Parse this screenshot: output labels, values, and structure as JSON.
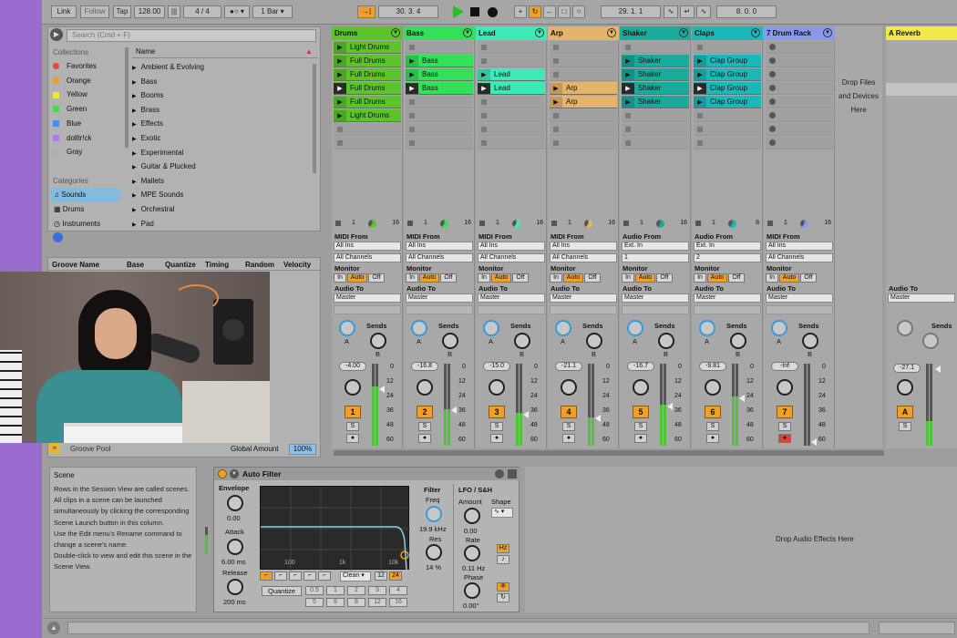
{
  "transport": {
    "link": "Link",
    "follow": "Follow",
    "tap": "Tap",
    "tempo": "128.00",
    "signature": "4 / 4",
    "metro": "1 Bar",
    "position": "30.   3.   4",
    "loop_start": "29.   1.   1",
    "loop_len": "8.   0.   0"
  },
  "browser": {
    "search_placeholder": "Search (Cmd + F)",
    "name_header": "Name",
    "collections_header": "Collections",
    "collections": [
      {
        "label": "Favorites",
        "color": "#e8463e"
      },
      {
        "label": "Orange",
        "color": "#f39a2a"
      },
      {
        "label": "Yellow",
        "color": "#f2e63c"
      },
      {
        "label": "Green",
        "color": "#4ed44e"
      },
      {
        "label": "Blue",
        "color": "#4a8ff0"
      },
      {
        "label": "dolltr!ck",
        "color": "#b677e8"
      },
      {
        "label": "Gray",
        "color": "#b0b0b0"
      }
    ],
    "categories_header": "Categories",
    "categories": [
      "Sounds",
      "Drums",
      "Instruments"
    ],
    "items": [
      "Ambient & Evolving",
      "Bass",
      "Booms",
      "Brass",
      "Effects",
      "Exotic",
      "Experimental",
      "Guitar & Plucked",
      "Mallets",
      "MPE Sounds",
      "Orchestral",
      "Pad"
    ]
  },
  "groove": {
    "headers": [
      "Groove Name",
      "Base",
      "Quantize",
      "Timing",
      "Random",
      "Velocity"
    ],
    "pool_label": "Groove Pool",
    "global_label": "Global Amount",
    "global_value": "100%"
  },
  "tracks": [
    {
      "name": "Drums",
      "color": "#5bc42a",
      "clips": [
        "Light Drums",
        "Full Drums",
        "Full Drums",
        "Full Drums",
        "Full Drums",
        "Light Drums"
      ],
      "input_type": "MIDI From",
      "input": "All Ins",
      "channel": "All Channels",
      "vol": "-4.00",
      "num": "1",
      "meter": 0.72,
      "ticks_end": "16"
    },
    {
      "name": "Bass",
      "color": "#33e058",
      "clips": [
        "",
        "Bass",
        "Bass",
        "Bass",
        "",
        ""
      ],
      "input_type": "MIDI From",
      "input": "All Ins",
      "channel": "All Channels",
      "vol": "-16.8",
      "num": "2",
      "meter": 0.45,
      "ticks_end": "16"
    },
    {
      "name": "Lead",
      "color": "#3ee9b8",
      "clips": [
        "",
        "",
        "Lead",
        "Lead",
        "",
        ""
      ],
      "input_type": "MIDI From",
      "input": "All Ins",
      "channel": "All Channels",
      "vol": "-15.0",
      "num": "3",
      "meter": 0.4,
      "ticks_end": "16"
    },
    {
      "name": "Arp",
      "color": "#e3b46a",
      "clips": [
        "",
        "",
        "",
        "Arp",
        "Arp",
        ""
      ],
      "input_type": "MIDI From",
      "input": "All Ins",
      "channel": "All Channels",
      "vol": "-21.1",
      "num": "4",
      "meter": 0.35,
      "ticks_end": "16"
    },
    {
      "name": "Shaker",
      "color": "#1aaa9c",
      "clips": [
        "",
        "Shaker",
        "Shaker",
        "Shaker",
        "Shaker",
        ""
      ],
      "input_type": "Audio From",
      "input": "Ext. In",
      "channel": "1",
      "vol": "-16.7",
      "num": "5",
      "meter": 0.5,
      "ticks_end": "16"
    },
    {
      "name": "Claps",
      "color": "#1ab8b8",
      "clips": [
        "",
        "Clap Group",
        "Clap Group",
        "Clap Group",
        "Clap Group",
        ""
      ],
      "input_type": "Audio From",
      "input": "Ext. In",
      "channel": "2",
      "vol": "-9.81",
      "num": "6",
      "meter": 0.6,
      "ticks_end": "8"
    },
    {
      "name": "7 Drum Rack",
      "color": "#8899ee",
      "clips": [
        "",
        "",
        "",
        "",
        "",
        ""
      ],
      "input_type": "MIDI From",
      "input": "All Ins",
      "channel": "All Channels",
      "vol": "-Inf",
      "num": "7",
      "meter": 0.0,
      "ticks_end": "16"
    }
  ],
  "mixer_labels": {
    "monitor": "Monitor",
    "in": "In",
    "auto": "Auto",
    "off": "Off",
    "audio_to": "Audio To",
    "master": "Master",
    "sends": "Sends",
    "a": "A",
    "b": "B",
    "s": "S"
  },
  "drop_files": "Drop Files and Devices Here",
  "return": {
    "name": "A Reverb",
    "vol": "-27.1",
    "letter": "A",
    "audio_to": "Audio To",
    "master": "Master"
  },
  "db_ticks": [
    "0",
    "12",
    "24",
    "36",
    "48",
    "60"
  ],
  "info": {
    "title": "Scene",
    "text": "Rows in the Session View are called scenes. All clips in a scene can be launched simultaneously by clicking the corresponding Scene Launch button in this column.\nUse the Edit menu's Rename command to change a scene's name.\nDouble-click to view and edit this scene in the Scene View."
  },
  "device": {
    "title": "Auto Filter",
    "envelope": "Envelope",
    "env_val": "0.00",
    "attack": "Attack",
    "attack_val": "6.00 ms",
    "release": "Release",
    "release_val": "200 ms",
    "freq_ticks": [
      "100",
      "1k",
      "10k"
    ],
    "filter": "Filter",
    "freq": "Freq",
    "freq_val": "19.9 kHz",
    "res": "Res",
    "res_val": "14 %",
    "lfo": "LFO / S&H",
    "amount": "Amount",
    "amount_val": "0.00",
    "shape": "Shape",
    "rate": "Rate",
    "rate_val": "0.11 Hz",
    "phase": "Phase",
    "phase_val": "0.00°",
    "hz": "Hz",
    "mode": "Clean",
    "slope_a": "12",
    "slope_b": "24",
    "quantize": "Quantize",
    "quant_vals": [
      "0.5",
      "1",
      "2",
      "3",
      "4",
      "5",
      "6",
      "8",
      "12",
      "16"
    ]
  },
  "drop_effects": "Drop Audio Effects Here"
}
